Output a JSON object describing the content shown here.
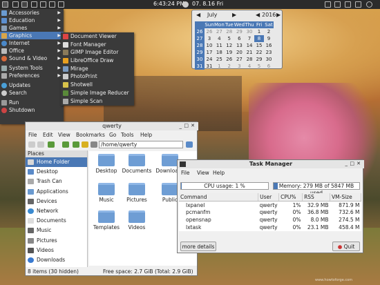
{
  "panel": {
    "clock": "6:43:24 PM",
    "date": "07. 8.16 Fri"
  },
  "menu": {
    "items": [
      {
        "label": "Accessories"
      },
      {
        "label": "Education"
      },
      {
        "label": "Games"
      },
      {
        "label": "Graphics"
      },
      {
        "label": "Internet"
      },
      {
        "label": "Office"
      },
      {
        "label": "Sound & Video"
      },
      {
        "label": "System Tools"
      },
      {
        "label": "Preferences"
      },
      {
        "label": "Updates"
      },
      {
        "label": "Search"
      },
      {
        "label": "Run"
      },
      {
        "label": "Shutdown"
      }
    ],
    "graphics_submenu": [
      {
        "label": "Document Viewer"
      },
      {
        "label": "Font Manager"
      },
      {
        "label": "GIMP Image Editor"
      },
      {
        "label": "LibreOffice Draw"
      },
      {
        "label": "Mirage"
      },
      {
        "label": "PhotoPrint"
      },
      {
        "label": "Shotwell"
      },
      {
        "label": "Simple Image Reducer"
      },
      {
        "label": "Simple Scan"
      }
    ]
  },
  "calendar": {
    "month": "July",
    "year": "2016",
    "weekdays": [
      "Sun",
      "Mon",
      "Tue",
      "Wed",
      "Thu",
      "Fri",
      "Sat"
    ],
    "weeks": [
      {
        "wk": "26",
        "days": [
          "26",
          "27",
          "28",
          "29",
          "30",
          "1",
          "2"
        ]
      },
      {
        "wk": "27",
        "days": [
          "3",
          "4",
          "5",
          "6",
          "7",
          "8",
          "9"
        ]
      },
      {
        "wk": "28",
        "days": [
          "10",
          "11",
          "12",
          "13",
          "14",
          "15",
          "16"
        ]
      },
      {
        "wk": "29",
        "days": [
          "17",
          "18",
          "19",
          "20",
          "21",
          "22",
          "23"
        ]
      },
      {
        "wk": "30",
        "days": [
          "24",
          "25",
          "26",
          "27",
          "28",
          "29",
          "30"
        ]
      },
      {
        "wk": "31",
        "days": [
          "31",
          "1",
          "2",
          "3",
          "4",
          "5",
          "6"
        ]
      }
    ],
    "today": "8"
  },
  "file_manager": {
    "title": "qwerty",
    "menubar": [
      "File",
      "Edit",
      "View",
      "Bookmarks",
      "Go",
      "Tools",
      "Help"
    ],
    "address": "/home/qwerty",
    "places_header": "Places",
    "places": [
      {
        "label": "Home Folder"
      },
      {
        "label": "Desktop"
      },
      {
        "label": "Trash Can"
      },
      {
        "label": "Applications"
      },
      {
        "label": "Devices"
      },
      {
        "label": "Network"
      },
      {
        "label": "Documents"
      },
      {
        "label": "Music"
      },
      {
        "label": "Pictures"
      },
      {
        "label": "Videos"
      },
      {
        "label": "Downloads"
      }
    ],
    "files": [
      "Desktop",
      "Documents",
      "Downloads",
      "Music",
      "Pictures",
      "Public",
      "Templates",
      "Videos"
    ],
    "status_left": "8 items (30 hidden)",
    "status_right": "Free space: 2.7 GiB (Total: 2.9 GiB)"
  },
  "task_manager": {
    "title": "Task Manager",
    "menubar": [
      "File",
      "View",
      "Help"
    ],
    "cpu_label": "CPU usage: 1 %",
    "cpu_fraction": 0.01,
    "mem_label": "Memory: 279 MB of 5847 MB used",
    "mem_fraction": 0.048,
    "columns": [
      "Command",
      "User",
      "CPU%",
      "RSS",
      "VM-Size"
    ],
    "rows": [
      {
        "command": "lxpanel",
        "user": "qwerty",
        "cpu": "1%",
        "rss": "32.9 MB",
        "vm": "871.9 M"
      },
      {
        "command": "pcmanfm",
        "user": "qwerty",
        "cpu": "0%",
        "rss": "36.8 MB",
        "vm": "732.6 M"
      },
      {
        "command": "opensnap",
        "user": "qwerty",
        "cpu": "0%",
        "rss": "8.0 MB",
        "vm": "274.5 M"
      },
      {
        "command": "lxtask",
        "user": "qwerty",
        "cpu": "0%",
        "rss": "23.1 MB",
        "vm": "458.4 M"
      }
    ],
    "more_details": "more details",
    "quit": "Quit"
  },
  "watermark": "www.howtoforge.com"
}
